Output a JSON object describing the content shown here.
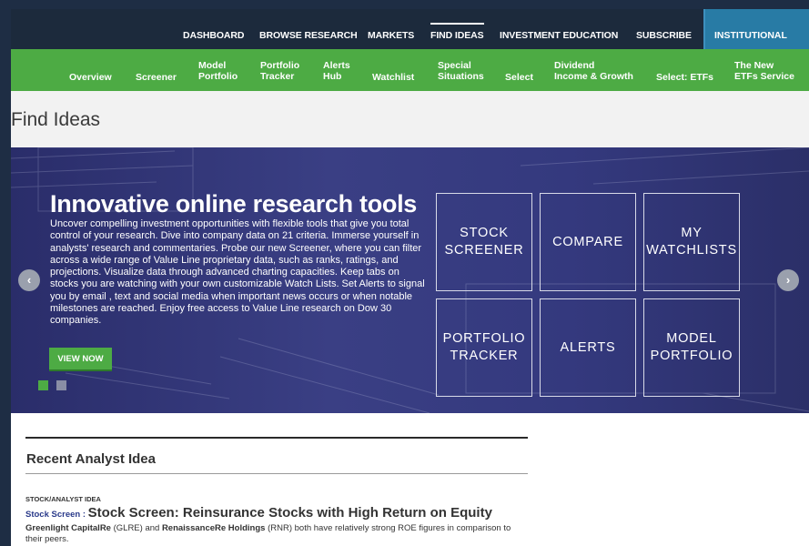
{
  "topnav": {
    "items": [
      {
        "label": "DASHBOARD"
      },
      {
        "label": "BROWSE RESEARCH"
      },
      {
        "label": "MARKETS"
      },
      {
        "label": "FIND IDEAS"
      },
      {
        "label": "INVESTMENT EDUCATION"
      },
      {
        "label": "SUBSCRIBE"
      }
    ],
    "institutional": "INSTITUTIONAL",
    "active": "FIND IDEAS"
  },
  "subnav": {
    "items": [
      {
        "line1": "Overview",
        "line2": ""
      },
      {
        "line1": "Screener",
        "line2": ""
      },
      {
        "line1": "Model",
        "line2": "Portfolio"
      },
      {
        "line1": "Portfolio",
        "line2": "Tracker"
      },
      {
        "line1": "Alerts",
        "line2": "Hub"
      },
      {
        "line1": "Watchlist",
        "line2": ""
      },
      {
        "line1": "Special",
        "line2": "Situations"
      },
      {
        "line1": "Select",
        "line2": ""
      },
      {
        "line1": "Dividend",
        "line2": "Income & Growth"
      },
      {
        "line1": "Select: ETFs",
        "line2": ""
      },
      {
        "line1": "The New",
        "line2": "ETFs Service"
      }
    ]
  },
  "page_title": "Find Ideas",
  "hero": {
    "headline": "Innovative online research tools",
    "body": "Uncover compelling investment opportunities with flexible tools that give you total control of your research.  Dive into company data on 21 criteria.  Immerse yourself in analysts' research and commentaries.  Probe our new Screener, where you can filter across a wide range of Value Line proprietary data, such as ranks, ratings, and projections.  Visualize data through advanced charting capacities.  Keep tabs on stocks you are watching with your own customizable Watch Lists.  Set Alerts to signal you by email , text and social media when important news occurs or when notable milestones are reached. Enjoy free access to Value Line research on Dow 30 companies.",
    "cta": "VIEW NOW",
    "tiles": [
      {
        "line1": "STOCK",
        "line2": "SCREENER"
      },
      {
        "line1": "COMPARE",
        "line2": ""
      },
      {
        "line1": "MY",
        "line2": "WATCHLISTS"
      },
      {
        "line1": "PORTFOLIO",
        "line2": "TRACKER"
      },
      {
        "line1": "ALERTS",
        "line2": ""
      },
      {
        "line1": "MODEL",
        "line2": "PORTFOLIO"
      }
    ],
    "prev_icon": "‹",
    "next_icon": "›"
  },
  "recent_idea": {
    "heading": "Recent Analyst Idea",
    "category": "STOCK/ANALYST IDEA",
    "type": "Stock Screen",
    "separator": " : ",
    "title": "Stock Screen: Reinsurance Stocks with High Return on Equity",
    "company1": "Greenlight CapitalRe",
    "ticker1": " (GLRE) and ",
    "company2": "RenaissanceRe Holdings",
    "summary_rest": " (RNR) both have relatively strong ROE figures in comparison to their peers."
  },
  "colors": {
    "nav_dark": "#1c2a3c",
    "nav_green": "#4dab44",
    "institutional_blue": "#287ba5",
    "hero_purple": "#34397e"
  },
  "icons": {
    "prev": "chevron-left-icon",
    "next": "chevron-right-icon"
  }
}
